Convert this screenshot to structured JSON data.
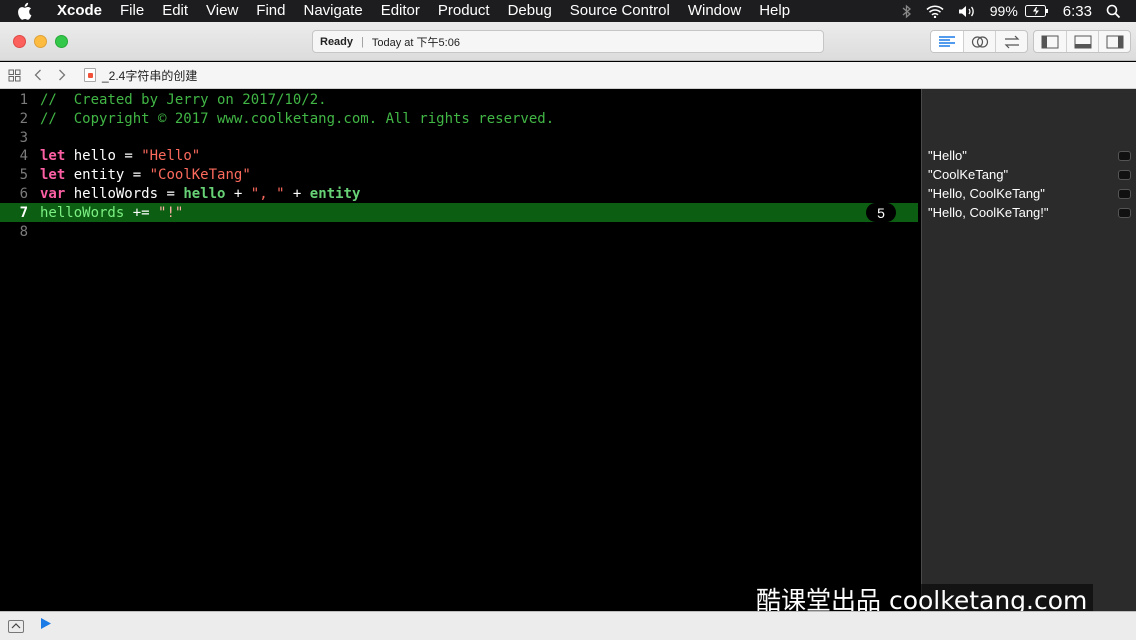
{
  "menubar": {
    "app": "Xcode",
    "items": [
      "File",
      "Edit",
      "View",
      "Find",
      "Navigate",
      "Editor",
      "Product",
      "Debug",
      "Source Control",
      "Window",
      "Help"
    ],
    "battery": "99%",
    "time": "6:33",
    "icons": [
      "apple-icon",
      "bluetooth-icon",
      "wifi-icon",
      "volume-icon",
      "battery-icon",
      "spotlight-search-icon"
    ]
  },
  "toolbar": {
    "status": "Ready",
    "timestamp": "Today at 下午5:06"
  },
  "jumpbar": {
    "file": "_2.4字符串的创建"
  },
  "editor": {
    "lines": [
      {
        "n": "1"
      },
      {
        "n": "2"
      },
      {
        "n": "3"
      },
      {
        "n": "4"
      },
      {
        "n": "5"
      },
      {
        "n": "6"
      },
      {
        "n": "7"
      },
      {
        "n": "8"
      }
    ],
    "tokens": {
      "c1": "//  Created by Jerry on 2017/10/2.",
      "c2": "//  Copyright © 2017 www.coolketang.com. All rights reserved.",
      "let": "let",
      "var": "var",
      "hello": "hello",
      "eq": " = ",
      "hello_str": "\"Hello\"",
      "entity": "entity",
      "entity_str": "\"CoolKeTang\"",
      "helloWords": "helloWords",
      "plus": " + ",
      "comma_str": "\", \"",
      "plus_eq": " += ",
      "bang_str": "\"!\""
    },
    "exec_count": "5"
  },
  "results": [
    "\"Hello\"",
    "\"CoolKeTang\"",
    "\"Hello, CoolKeTang\"",
    "\"Hello, CoolKeTang!\""
  ],
  "watermark": "酷课堂出品 coolketang.com",
  "colors": {
    "highlight": "#0c5e12",
    "keyword": "#fc5fa3",
    "string": "#fc6a5d",
    "comment": "#41b645",
    "identifier": "#67d276"
  }
}
